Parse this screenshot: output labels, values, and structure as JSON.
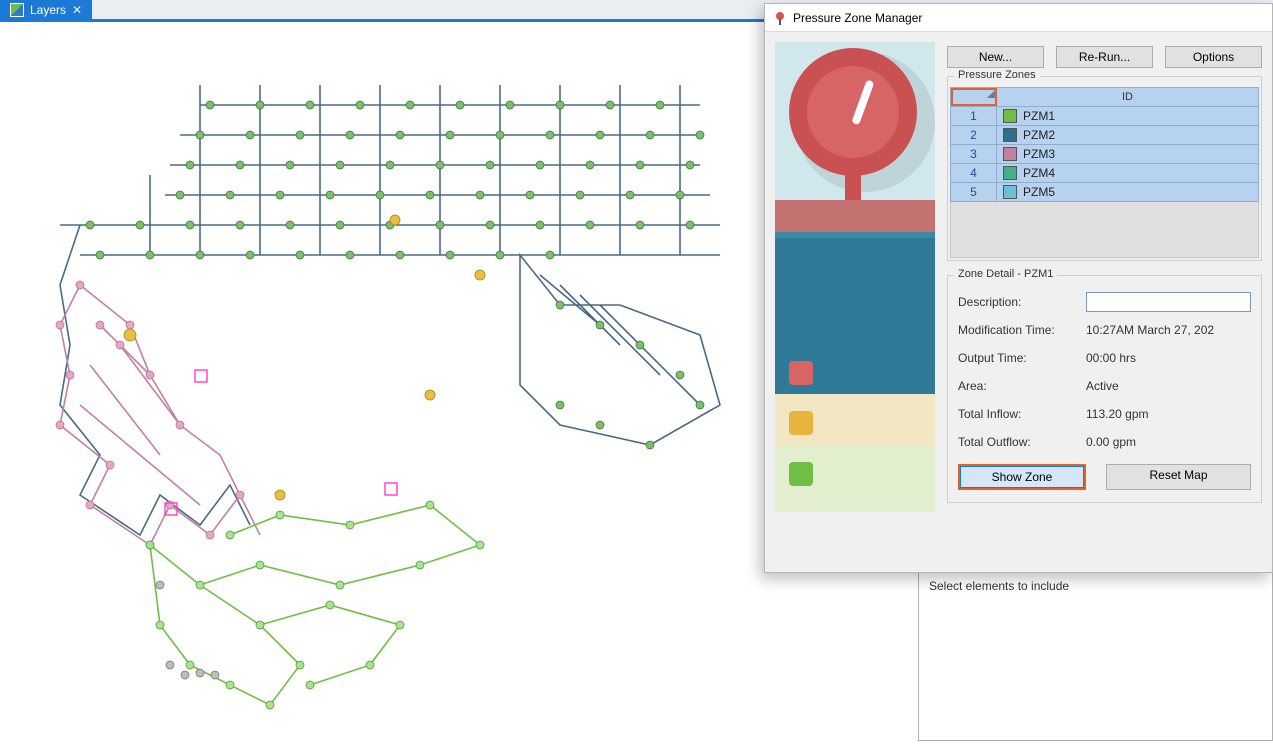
{
  "tab": {
    "label": "Layers"
  },
  "dialog": {
    "title": "Pressure Zone Manager",
    "buttons": {
      "new": "New...",
      "rerun": "Re-Run...",
      "options": "Options"
    },
    "zones_label": "Pressure Zones",
    "grid": {
      "id_header": "ID",
      "rows": [
        {
          "n": "1",
          "color": "#6fbf44",
          "id": "PZM1"
        },
        {
          "n": "2",
          "color": "#2e6f8e",
          "id": "PZM2"
        },
        {
          "n": "3",
          "color": "#c37fa0",
          "id": "PZM3"
        },
        {
          "n": "4",
          "color": "#43b28a",
          "id": "PZM4"
        },
        {
          "n": "5",
          "color": "#6fc0d6",
          "id": "PZM5"
        }
      ]
    },
    "detail": {
      "title": "Zone Detail - PZM1",
      "description_lbl": "Description:",
      "description_val": "",
      "modtime_lbl": "Modification Time:",
      "modtime_val": "10:27AM March 27, 202",
      "outtime_lbl": "Output Time:",
      "outtime_val": "00:00 hrs",
      "area_lbl": "Area:",
      "area_val": "Active",
      "inflow_lbl": "Total Inflow:",
      "inflow_val": "113.20 gpm",
      "outflow_lbl": "Total Outflow:",
      "outflow_val": "0.00 gpm",
      "showzone": "Show Zone",
      "resetmap": "Reset Map"
    }
  },
  "rightpanel": {
    "line": "Select elements to include"
  }
}
